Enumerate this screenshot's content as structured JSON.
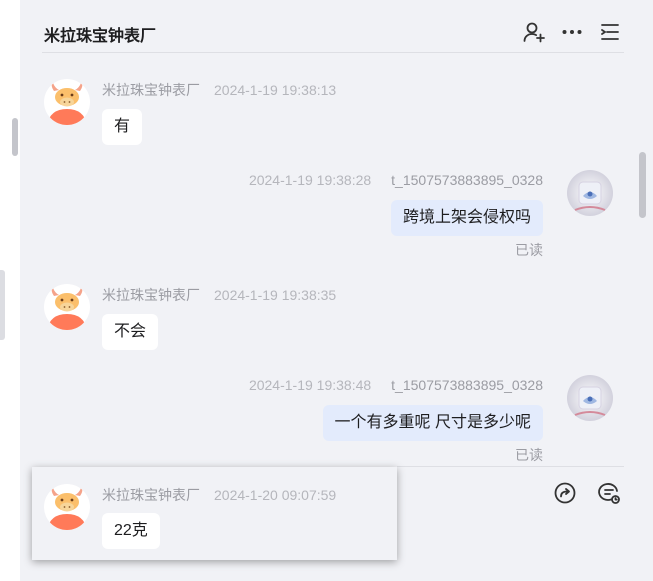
{
  "header": {
    "title": "米拉珠宝钟表厂",
    "icons": [
      "add-user-icon",
      "more-icon",
      "menu-list-icon"
    ]
  },
  "messages": [
    {
      "sender": "米拉珠宝钟表厂",
      "time": "2024-1-19 19:38:13",
      "text": "有",
      "side": "left"
    },
    {
      "sender": "t_1507573883895_0328",
      "time": "2024-1-19 19:38:28",
      "text": "跨境上架会侵权吗",
      "side": "right",
      "status": "已读"
    },
    {
      "sender": "米拉珠宝钟表厂",
      "time": "2024-1-19 19:38:35",
      "text": "不会",
      "side": "left"
    },
    {
      "sender": "t_1507573883895_0328",
      "time": "2024-1-19 19:38:48",
      "text": "一个有多重呢 尺寸是多少呢",
      "side": "right",
      "status": "已读"
    }
  ],
  "popup": {
    "sender": "米拉珠宝钟表厂",
    "time": "2024-1-20 09:07:59",
    "text": "22克"
  },
  "actions": [
    "share-icon",
    "chat-history-icon"
  ],
  "colors": {
    "background": "#f1f2f6",
    "my_bubble": "#e3ebfc",
    "their_bubble": "#ffffff",
    "avatar_bg": "#ff7a59"
  }
}
